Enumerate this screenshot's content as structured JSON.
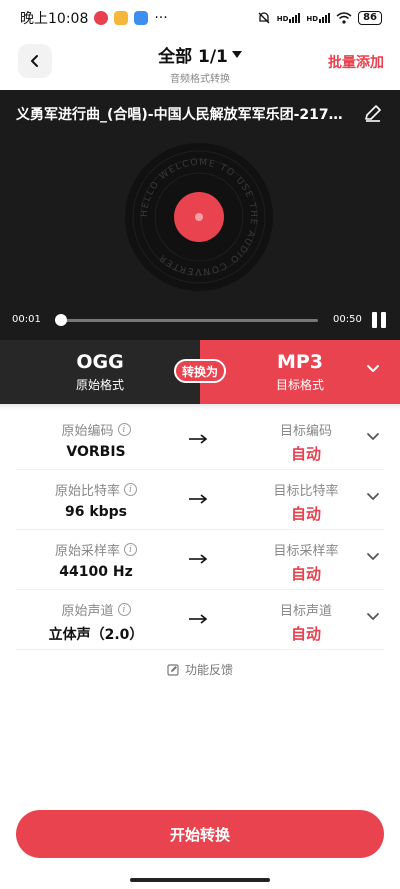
{
  "status_bar": {
    "time": "晚上10:08",
    "more": "···",
    "signal_1": "HD",
    "signal_2": "HD",
    "battery": "86",
    "colors": {
      "app1": "#e8404e",
      "app2": "#f5b73b",
      "app3": "#3d8ef0"
    }
  },
  "header": {
    "title": "全部 1/1",
    "subtitle": "音频格式转换",
    "batch_add": "批量添加"
  },
  "player": {
    "track_title": "义勇军进行曲_(合唱)-中国人民解放军军乐团-21764...",
    "disc_text": "HELLO WELCOME TO USE THE AUDIO CONVERTER",
    "current_time": "00:01",
    "total_time": "00:50",
    "progress_fraction": 0.02
  },
  "formats": {
    "source_format": "OGG",
    "source_caption": "原始格式",
    "convert_badge": "转换为",
    "target_format": "MP3",
    "target_caption": "目标格式"
  },
  "params": [
    {
      "label": "原始编码",
      "value": "VORBIS",
      "target_label": "目标编码",
      "target_value": "自动"
    },
    {
      "label": "原始比特率",
      "value": "96 kbps",
      "target_label": "目标比特率",
      "target_value": "自动"
    },
    {
      "label": "原始采样率",
      "value": "44100 Hz",
      "target_label": "目标采样率",
      "target_value": "自动"
    },
    {
      "label": "原始声道",
      "value": "立体声（2.0）",
      "target_label": "目标声道",
      "target_value": "自动"
    }
  ],
  "info_glyph": "i",
  "feedback": "功能反馈",
  "start_button": "开始转换",
  "theme": {
    "accent": "#e8434f",
    "dark": "#272727"
  }
}
